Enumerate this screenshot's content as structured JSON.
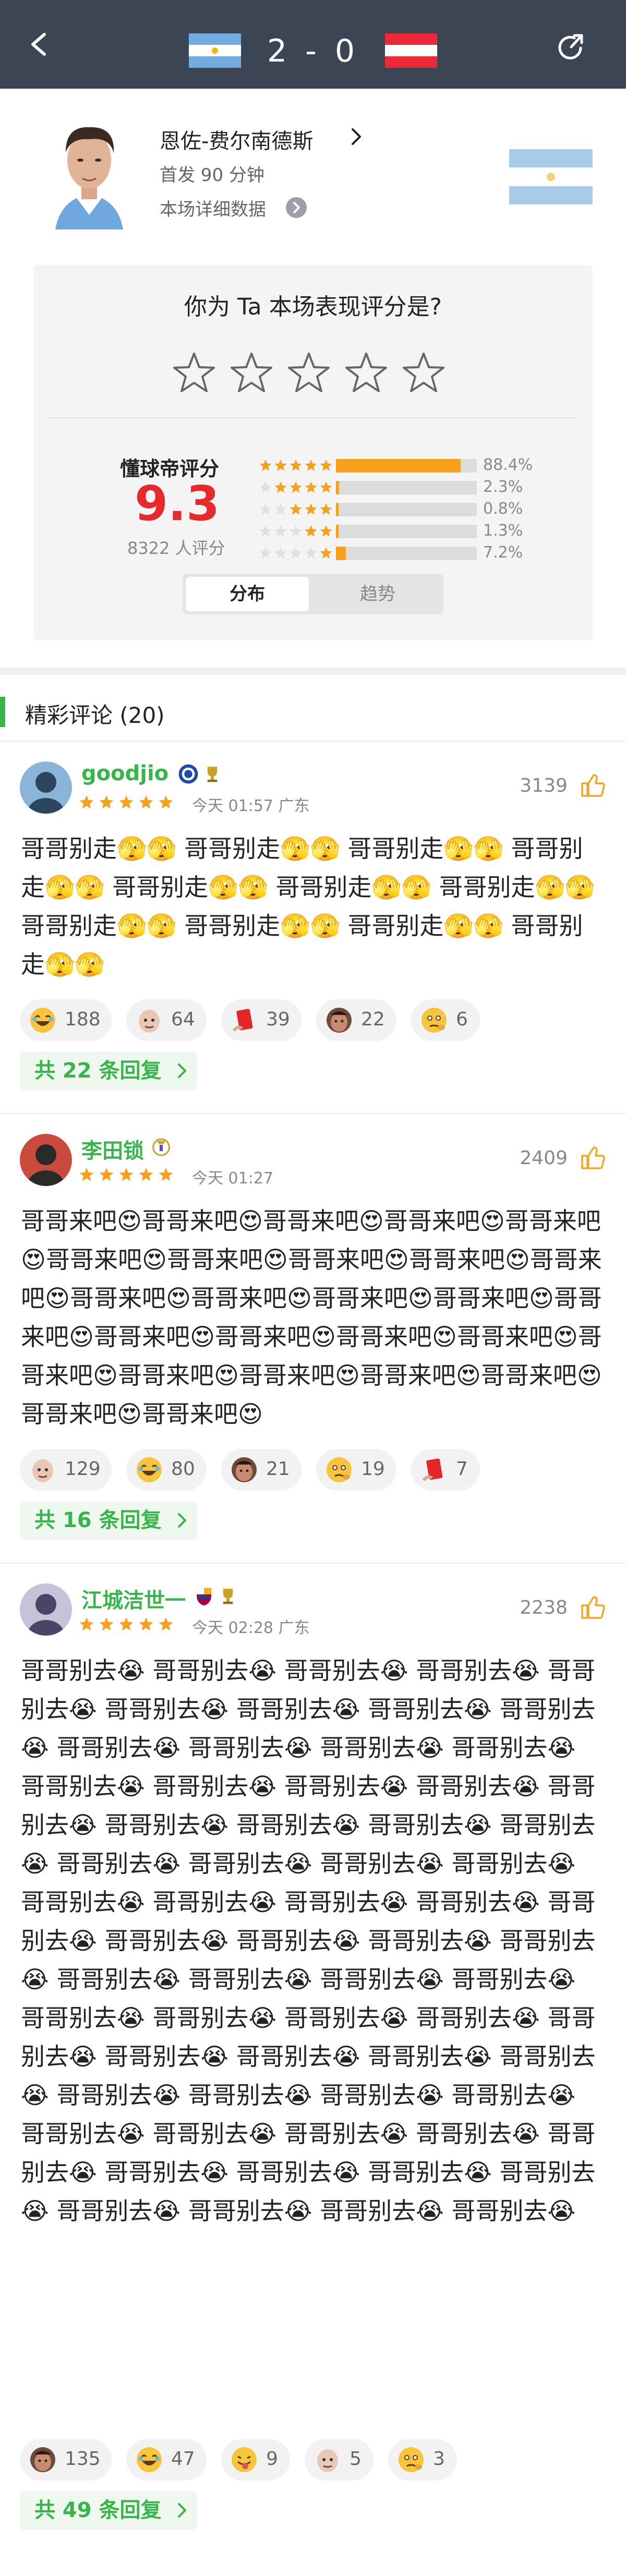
{
  "header": {
    "score": "2 - 0",
    "home_flag": "flag-argentina",
    "away_flag": "flag-austria"
  },
  "player": {
    "name": "恩佐-费尔南德斯",
    "minutes": "首发 90 分钟",
    "detail_link": "本场详细数据"
  },
  "rating_prompt": {
    "question": "你为 Ta 本场表现评分是?",
    "star_count": 5
  },
  "dongqiudi_rating": {
    "title": "懂球帝评分",
    "score": "9.3",
    "count": "8322 人评分",
    "distribution": [
      {
        "stars": 5,
        "percent": 88.4,
        "label": "88.4%"
      },
      {
        "stars": 4,
        "percent": 2.3,
        "label": "2.3%"
      },
      {
        "stars": 3,
        "percent": 0.8,
        "label": "0.8%"
      },
      {
        "stars": 2,
        "percent": 1.3,
        "label": "1.3%"
      },
      {
        "stars": 1,
        "percent": 7.2,
        "label": "7.2%"
      }
    ]
  },
  "tabs": {
    "distribution": "分布",
    "trend": "趋势"
  },
  "comments_section": {
    "title": "精彩评论 (20)"
  },
  "comments": [
    {
      "username": "goodjio",
      "badges": [
        "chelsea-badge-icon",
        "trophy-badge-icon"
      ],
      "stars": 5,
      "time": "今天 01:57 广东",
      "likes": "3139",
      "text": "哥哥别走🫣🫣 哥哥别走🫣🫣 哥哥别走🫣🫣 哥哥别走🫣🫣 哥哥别走🫣🫣 哥哥别走🫣🫣 哥哥别走🫣🫣 哥哥别走🫣🫣 哥哥别走🫣🫣 哥哥别走🫣🫣 哥哥别走🫣🫣",
      "reactions": [
        {
          "icon": "laugh-emoji-icon",
          "count": "188"
        },
        {
          "icon": "bald-head-icon",
          "count": "64"
        },
        {
          "icon": "red-card-icon",
          "count": "39"
        },
        {
          "icon": "face-avatar-icon",
          "count": "22"
        },
        {
          "icon": "thinking-emoji-icon",
          "count": "6"
        }
      ],
      "replies": "共 22 条回复"
    },
    {
      "username": "李田锁",
      "badges": [
        "realmadrid-badge-icon"
      ],
      "stars": 5,
      "time": "今天 01:27",
      "likes": "2409",
      "text": "哥哥来吧😍哥哥来吧😍哥哥来吧😍哥哥来吧😍哥哥来吧😍哥哥来吧😍哥哥来吧😍哥哥来吧😍哥哥来吧😍哥哥来吧😍哥哥来吧😍哥哥来吧😍哥哥来吧😍哥哥来吧😍哥哥来吧😍哥哥来吧😍哥哥来吧😍哥哥来吧😍哥哥来吧😍哥哥来吧😍哥哥来吧😍哥哥来吧😍哥哥来吧😍哥哥来吧😍哥哥来吧😍哥哥来吧😍",
      "reactions": [
        {
          "icon": "bald-head-icon",
          "count": "129"
        },
        {
          "icon": "laugh-emoji-icon",
          "count": "80"
        },
        {
          "icon": "face-avatar-icon",
          "count": "21"
        },
        {
          "icon": "thinking-emoji-icon",
          "count": "19"
        },
        {
          "icon": "red-card-icon",
          "count": "7"
        }
      ],
      "replies": "共 16 条回复"
    },
    {
      "username": "江城洁世一",
      "badges": [
        "barcelona-badge-icon",
        "trophy-badge-icon"
      ],
      "stars": 5,
      "time": "今天 02:28 广东",
      "likes": "2238",
      "text": "哥哥别去😭 哥哥别去😭 哥哥别去😭 哥哥别去😭 哥哥别去😭 哥哥别去😭 哥哥别去😭 哥哥别去😭 哥哥别去😭 哥哥别去😭 哥哥别去😭 哥哥别去😭 哥哥别去😭 哥哥别去😭 哥哥别去😭 哥哥别去😭 哥哥别去😭 哥哥别去😭 哥哥别去😭 哥哥别去😭 哥哥别去😭 哥哥别去😭 哥哥别去😭 哥哥别去😭 哥哥别去😭 哥哥别去😭 哥哥别去😭 哥哥别去😭 哥哥别去😭 哥哥别去😭 哥哥别去😭 哥哥别去😭 哥哥别去😭 哥哥别去😭 哥哥别去😭 哥哥别去😭 哥哥别去😭 哥哥别去😭 哥哥别去😭 哥哥别去😭 哥哥别去😭 哥哥别去😭 哥哥别去😭 哥哥别去😭 哥哥别去😭 哥哥别去😭 哥哥别去😭 哥哥别去😭 哥哥别去😭 哥哥别去😭 哥哥别去😭 哥哥别去😭 哥哥别去😭 哥哥别去😭 哥哥别去😭 哥哥别去😭 哥哥别去😭 哥哥别去😭 哥哥别去😭 哥哥别去😭 哥哥别去😭 哥哥别去😭 哥哥别去😭 哥哥别去😭 哥哥别去😭",
      "reactions": [
        {
          "icon": "face-avatar-icon",
          "count": "135"
        },
        {
          "icon": "laugh-emoji-icon",
          "count": "47"
        },
        {
          "icon": "tongue-emoji-icon",
          "count": "9"
        },
        {
          "icon": "bald-head-icon",
          "count": "5"
        },
        {
          "icon": "thinking-emoji-icon",
          "count": "3"
        }
      ],
      "replies": "共 49 条回复"
    }
  ],
  "colors": {
    "header_bg": "#3b4553",
    "accent_green": "#38b54a",
    "rating_red": "#e8292b",
    "star_orange": "#f6a01b"
  }
}
